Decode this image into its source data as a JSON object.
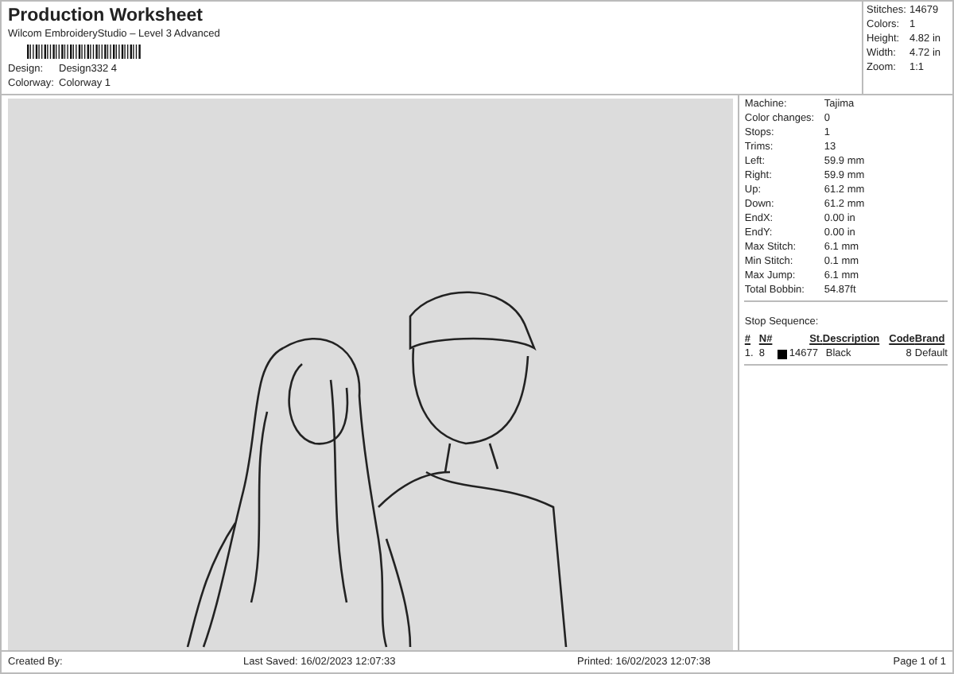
{
  "header": {
    "title": "Production Worksheet",
    "subtitle": "Wilcom EmbroideryStudio – Level 3 Advanced",
    "fields": [
      {
        "label": "Design:",
        "value": "Design332 4"
      },
      {
        "label": "Colorway:",
        "value": "Colorway 1"
      }
    ]
  },
  "summary": [
    {
      "label": "Stitches:",
      "value": "14679"
    },
    {
      "label": "Colors:",
      "value": "1"
    },
    {
      "label": "Height:",
      "value": "4.82 in"
    },
    {
      "label": "Width:",
      "value": "4.72 in"
    },
    {
      "label": "Zoom:",
      "value": "1:1"
    }
  ],
  "details": [
    {
      "label": "Machine:",
      "value": "Tajima"
    },
    {
      "label": "Color changes:",
      "value": "0"
    },
    {
      "label": "Stops:",
      "value": "1"
    },
    {
      "label": "Trims:",
      "value": "13"
    },
    {
      "label": "Left:",
      "value": "59.9 mm"
    },
    {
      "label": "Right:",
      "value": "59.9 mm"
    },
    {
      "label": "Up:",
      "value": "61.2 mm"
    },
    {
      "label": "Down:",
      "value": "61.2 mm"
    },
    {
      "label": "EndX:",
      "value": "0.00 in"
    },
    {
      "label": "EndY:",
      "value": "0.00 in"
    },
    {
      "label": "Max Stitch:",
      "value": "6.1 mm"
    },
    {
      "label": "Min Stitch:",
      "value": "0.1 mm"
    },
    {
      "label": "Max Jump:",
      "value": "6.1 mm"
    },
    {
      "label": "Total Bobbin:",
      "value": "54.87ft"
    }
  ],
  "stop_sequence": {
    "title": "Stop Sequence:",
    "columns": [
      "#",
      "N#",
      "St.",
      "Description",
      "Code",
      "Brand"
    ],
    "rows": [
      {
        "index": "1.",
        "needle": "8",
        "color": "#000000",
        "stitches": "14677",
        "description": "Black",
        "code": "8",
        "brand": "Default"
      }
    ]
  },
  "footer": {
    "created_by": "Created By:",
    "last_saved": "Last Saved: 16/02/2023 12:07:33",
    "printed": "Printed: 16/02/2023 12:07:38",
    "page": "Page 1 of 1"
  }
}
